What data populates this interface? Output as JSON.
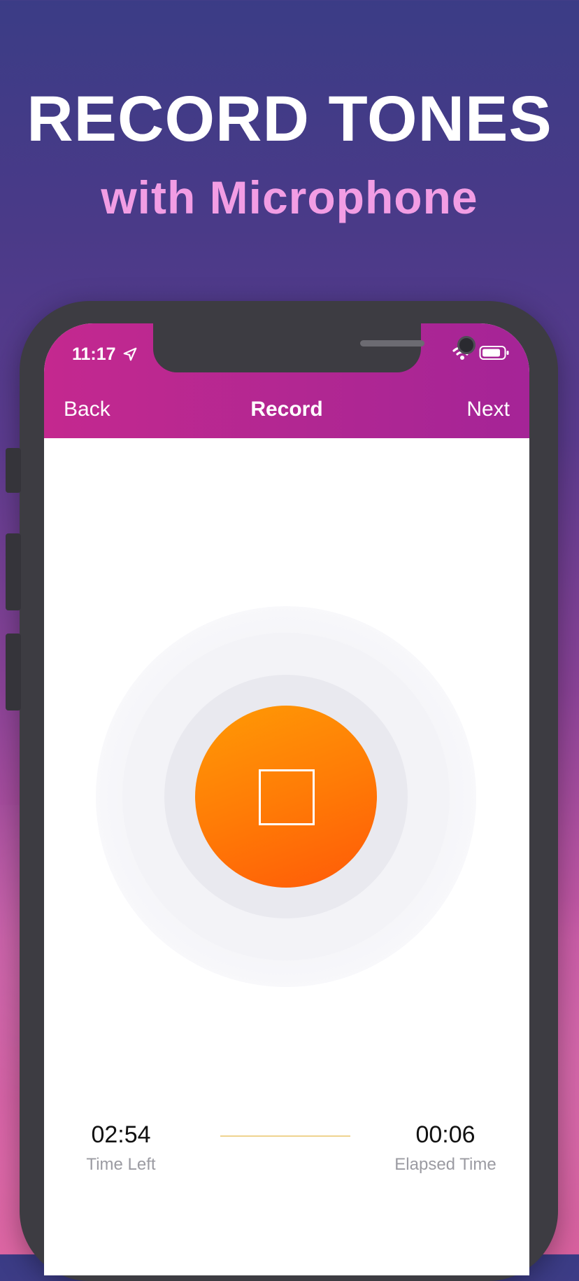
{
  "promo": {
    "headline": "RECORD TONES",
    "subheadline": "with Microphone"
  },
  "status_bar": {
    "time": "11:17"
  },
  "nav": {
    "back_label": "Back",
    "title": "Record",
    "next_label": "Next"
  },
  "record": {
    "state": "recording",
    "button_icon": "stop-square-icon",
    "accent_color": "#ff7c06"
  },
  "timers": {
    "time_left_value": "02:54",
    "time_left_label": "Time Left",
    "elapsed_value": "00:06",
    "elapsed_label": "Elapsed Time"
  },
  "colors": {
    "nav_bar": "#b12792",
    "subheadline": "#f29de4",
    "progress_line": "#efd38f"
  }
}
